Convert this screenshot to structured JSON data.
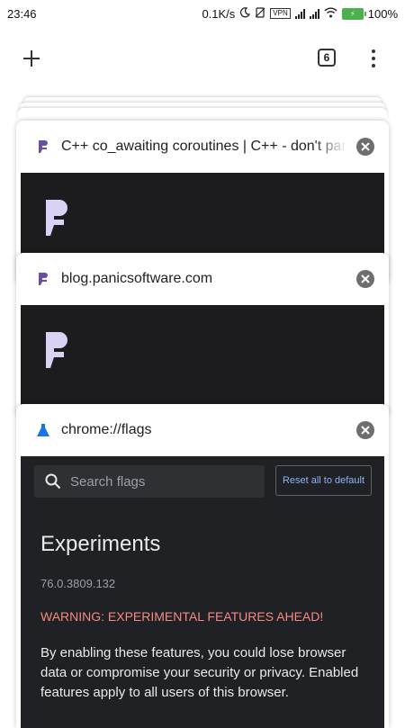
{
  "status_bar": {
    "time": "23:46",
    "net_speed": "0.1K/s",
    "vpn": "VPN",
    "battery_percent": "100%"
  },
  "toolbar": {
    "new_tab_icon": "plus-icon",
    "tab_count": "6",
    "menu_icon": "more-vert-icon"
  },
  "tabs": [
    {
      "title": "C++ co_awaiting coroutines | C++ - don't panic",
      "favicon": "panic-software-favicon"
    },
    {
      "title": "blog.panicsoftware.com",
      "favicon": "panic-software-favicon"
    },
    {
      "title": "chrome://flags",
      "favicon": "flask-icon"
    }
  ],
  "flags_page": {
    "search_placeholder": "Search flags",
    "reset_label": "Reset all to default",
    "heading": "Experiments",
    "version": "76.0.3809.132",
    "warning": "WARNING: EXPERIMENTAL FEATURES AHEAD!",
    "description": "By enabling these features, you could lose browser data or compromise your security or privacy. Enabled features apply to all users of this browser."
  },
  "colors": {
    "favicon_purple": "#6a4ea5",
    "flask_blue": "#1a73e8",
    "thumb_dark": "#1c1c1e",
    "logo_lavender": "#d9d2f4",
    "warning_red": "#f28b82",
    "link_blue": "#8ab4f8"
  }
}
